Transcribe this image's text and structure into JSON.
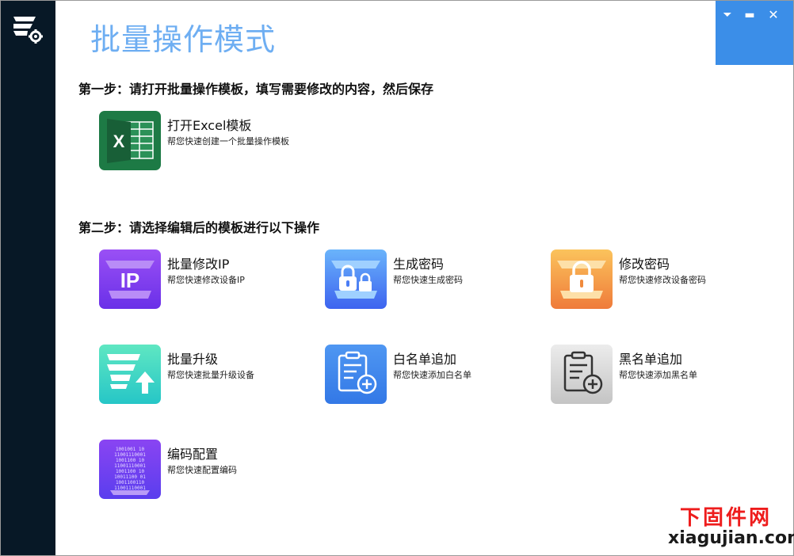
{
  "window": {
    "title": "批量操作模式",
    "controls": {
      "menu": "⏷",
      "minimize": "▬",
      "close": "✕"
    }
  },
  "steps": [
    {
      "label": "第一步：请打开批量操作模板，填写需要修改的内容，然后保存"
    },
    {
      "label": "第二步：请选择编辑后的模板进行以下操作"
    }
  ],
  "tiles": [
    {
      "title": "打开Excel模板",
      "desc": "帮您快速创建一个批量操作模板",
      "icon": "excel-icon"
    },
    {
      "title": "批量修改IP",
      "desc": "帮您快速修改设备IP",
      "icon": "ip-icon"
    },
    {
      "title": "生成密码",
      "desc": "帮您快速生成密码",
      "icon": "lock-icon"
    },
    {
      "title": "修改密码",
      "desc": "帮您快速修改设备密码",
      "icon": "lock-icon"
    },
    {
      "title": "批量升级",
      "desc": "帮您快速批量升级设备",
      "icon": "upgrade-icon"
    },
    {
      "title": "白名单追加",
      "desc": "帮您快速添加白名单",
      "icon": "clipboard-add-icon"
    },
    {
      "title": "黑名单追加",
      "desc": "帮您快速添加黑名单",
      "icon": "clipboard-add-icon"
    },
    {
      "title": "编码配置",
      "desc": "帮您快速配置编码",
      "icon": "binary-code-icon"
    }
  ],
  "watermark": {
    "cn": "下固件网",
    "en": "xiagujian.com"
  },
  "colors": {
    "sidebar": "#071826",
    "title": "#6eaef2",
    "window_controls": "#3b8ee8",
    "excel": "#1d7a45",
    "ip": "#7c3cf0",
    "generate_password": "#4a7df5",
    "modify_password": "#f08a3c",
    "upgrade": "#2fd3b9",
    "whitelist": "#3f86ee",
    "blacklist": "#cfcfcf",
    "encoding": "#6a3ef0"
  }
}
